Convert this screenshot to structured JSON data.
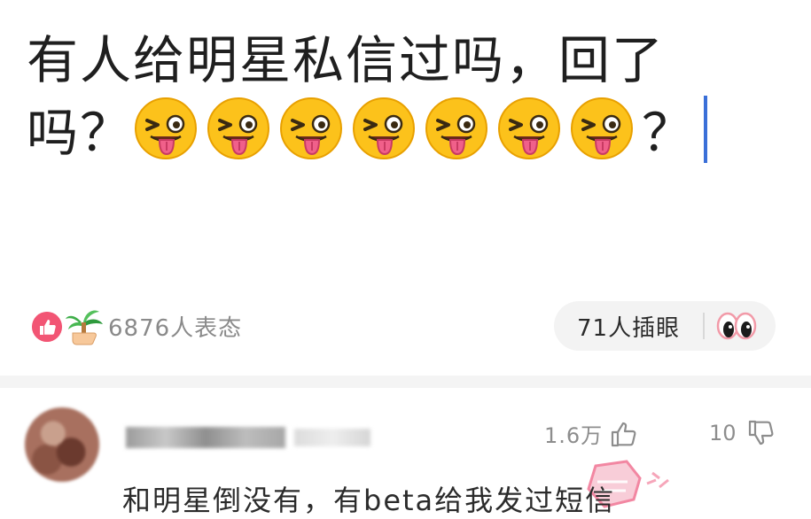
{
  "post": {
    "title_line1": "有人给明星私信过吗，回了",
    "title_line2_prefix": "吗？",
    "title_line2_suffix": "？",
    "emojis": [
      "tongue-wink-emoji",
      "tongue-wink-emoji",
      "tongue-wink-emoji",
      "tongue-wink-emoji",
      "tongue-wink-emoji",
      "tongue-wink-emoji",
      "tongue-wink-emoji"
    ]
  },
  "reactions": {
    "count_text": "6876人表态",
    "icons": [
      "thumbs-up-icon",
      "palm-tree-hand-icon"
    ]
  },
  "poke": {
    "label": "71人插眼",
    "icon": "eyes-icon"
  },
  "comment": {
    "likes": "1.6万",
    "replies": "10",
    "text": "和明星倒没有，有beta给我发过短信"
  },
  "colors": {
    "reaction_pink": "#f25574",
    "caret_blue": "#3a6fd8",
    "stamp_pink": "#f06a8c",
    "muted_text": "#8a8a8a"
  }
}
